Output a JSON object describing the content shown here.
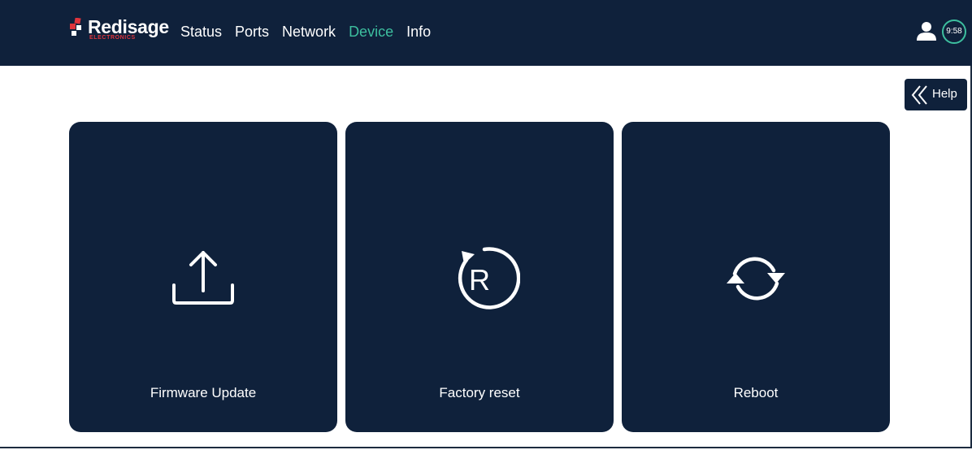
{
  "brand": {
    "name": "Redisage",
    "tagline": "ELECTRONICS",
    "accent_color": "#e0343c"
  },
  "nav": {
    "items": [
      {
        "label": "Status",
        "active": false
      },
      {
        "label": "Ports",
        "active": false
      },
      {
        "label": "Network",
        "active": false
      },
      {
        "label": "Device",
        "active": true
      },
      {
        "label": "Info",
        "active": false
      }
    ],
    "active_color": "#3dbf9f"
  },
  "header": {
    "user_icon": "user-icon",
    "clock_text": "9:58"
  },
  "help": {
    "label": "Help",
    "icon": "double-chevron-left-icon"
  },
  "cards": [
    {
      "label": "Firmware Update",
      "icon": "upload-icon"
    },
    {
      "label": "Factory reset",
      "icon": "factory-reset-icon"
    },
    {
      "label": "Reboot",
      "icon": "reboot-icon"
    }
  ],
  "colors": {
    "navy": "#0f213b",
    "white": "#ffffff"
  }
}
